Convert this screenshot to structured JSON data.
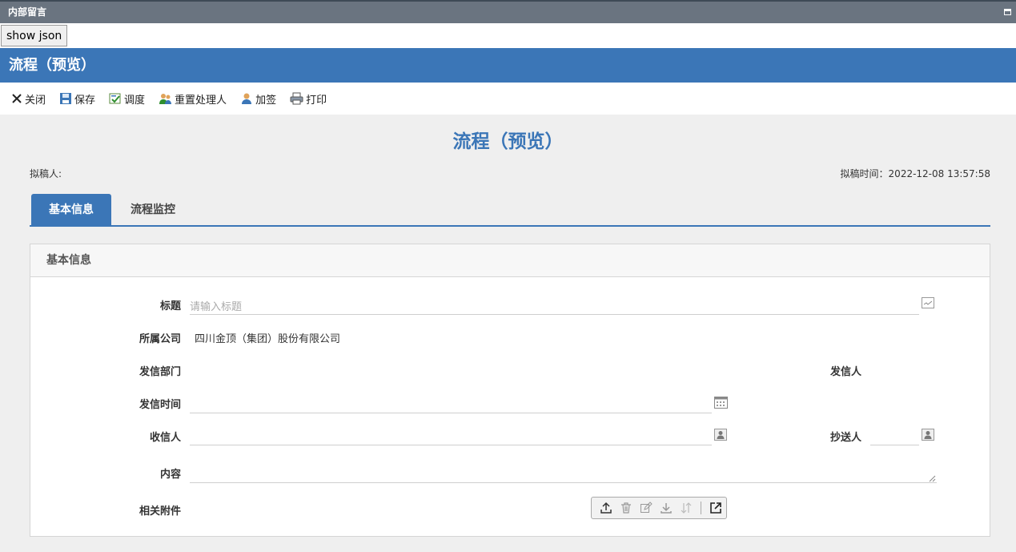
{
  "window": {
    "title": "内部留言"
  },
  "show_json_label": "show json",
  "header": {
    "title": "流程（预览）"
  },
  "toolbar": {
    "close": "关闭",
    "save": "保存",
    "dispatch": "调度",
    "reset_handler": "重置处理人",
    "add_sign": "加签",
    "print": "打印"
  },
  "document": {
    "title": "流程（预览）",
    "drafter_label": "拟稿人:",
    "draft_time": "拟稿时间：2022-12-08 13:57:58"
  },
  "tabs": [
    {
      "label": "基本信息",
      "active": true
    },
    {
      "label": "流程监控",
      "active": false
    }
  ],
  "form": {
    "section_title": "基本信息",
    "title_label": "标题",
    "title_placeholder": "请输入标题",
    "company_label": "所属公司",
    "company_value": "四川金顶（集团）股份有限公司",
    "dept_label": "发信部门",
    "sender_label": "发信人",
    "send_time_label": "发信时间",
    "recipient_label": "收信人",
    "cc_label": "抄送人",
    "content_label": "内容",
    "attachment_label": "相关附件"
  },
  "colors": {
    "accent": "#3b76b7",
    "titlebar": "#6a7480",
    "background": "#efefef"
  }
}
